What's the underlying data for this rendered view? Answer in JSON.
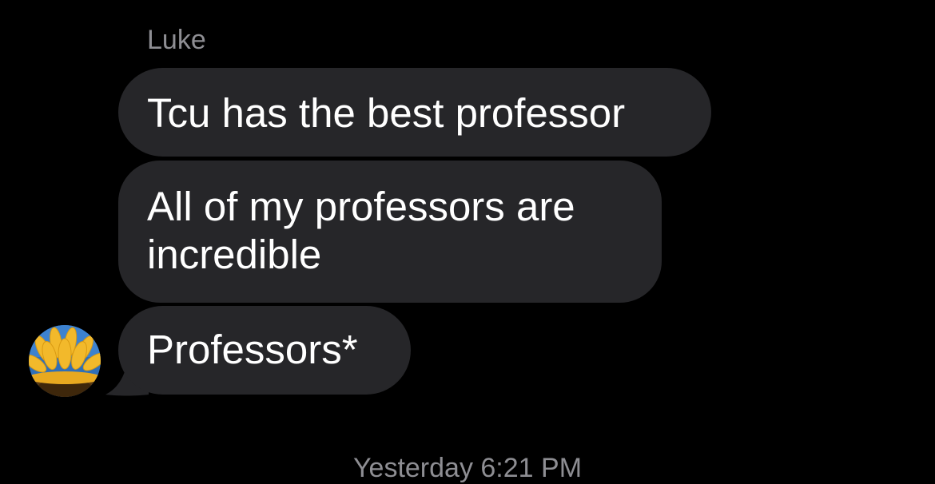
{
  "conversation": {
    "sender_name": "Luke",
    "messages": [
      {
        "text": "Tcu has the best professor"
      },
      {
        "text": "All of my professors are incredible"
      },
      {
        "text": "Professors*"
      }
    ],
    "avatar_icon": "sunflower-avatar",
    "timestamp": "Yesterday 6:21 PM"
  },
  "colors": {
    "background": "#000000",
    "bubble": "#262629",
    "secondary_text": "#8e8e93"
  }
}
